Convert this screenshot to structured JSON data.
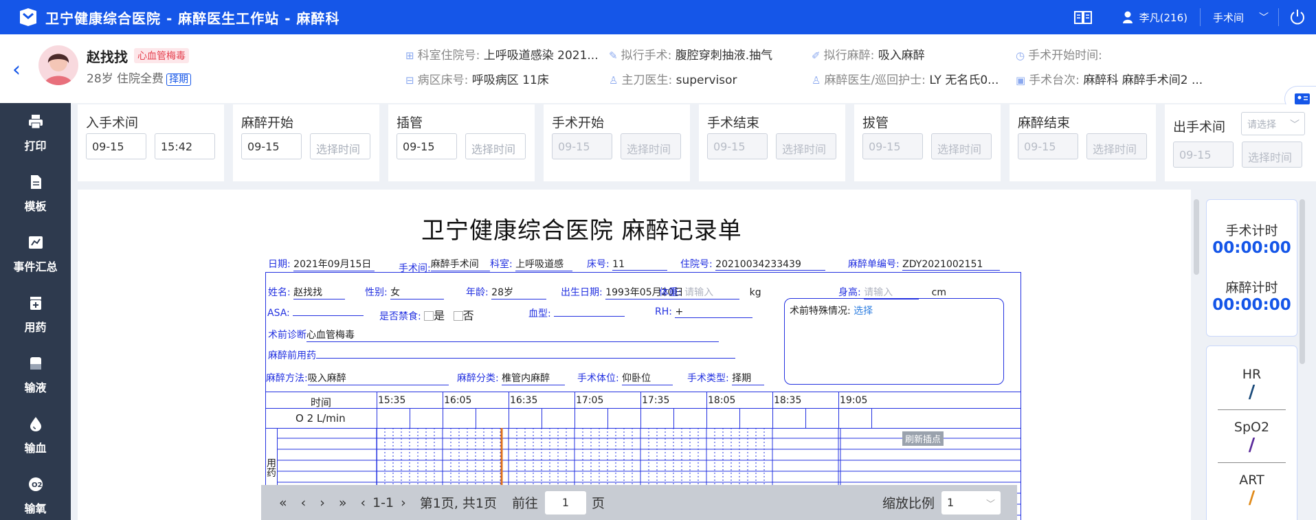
{
  "app": {
    "title": "卫宁健康综合医院 - 麻醉医生工作站 - 麻醉科",
    "user": "李凡(216)",
    "room": "手术间"
  },
  "patient": {
    "name": "赵找找",
    "tag": "心血管梅毒",
    "sub": "28岁 住院全费",
    "badge": "择期",
    "fields": [
      {
        "k": "科室住院号:",
        "v": "上呼吸道感染 2021..."
      },
      {
        "k": "病区床号:",
        "v": "呼吸病区 11床"
      },
      {
        "k": "拟行手术:",
        "v": "腹腔穿刺抽液.抽气"
      },
      {
        "k": "主刀医生:",
        "v": "supervisor"
      },
      {
        "k": "拟行麻醉:",
        "v": "吸入麻醉"
      },
      {
        "k": "麻醉医生/巡回护士:",
        "v": "LY 无名氏0..."
      },
      {
        "k": "手术开始时间:",
        "v": ""
      },
      {
        "k": "手术台次:",
        "v": "麻醉科 麻醉手术间2 ..."
      }
    ]
  },
  "sidebar": [
    "打印",
    "模板",
    "事件汇总",
    "用药",
    "输液",
    "输血",
    "输氧"
  ],
  "timeline": [
    {
      "label": "入手术间",
      "date": "09-15",
      "time": "15:42"
    },
    {
      "label": "麻醉开始",
      "date": "09-15",
      "time": "选择时间"
    },
    {
      "label": "插管",
      "date": "09-15",
      "time": "选择时间"
    },
    {
      "label": "手术开始",
      "date": "09-15",
      "time": "选择时间"
    },
    {
      "label": "手术结束",
      "date": "09-15",
      "time": "选择时间"
    },
    {
      "label": "拔管",
      "date": "09-15",
      "time": "选择时间"
    },
    {
      "label": "麻醉结束",
      "date": "09-15",
      "time": "选择时间"
    },
    {
      "label": "出手术间",
      "date": "09-15",
      "time": "选择时间",
      "select": "请选择"
    }
  ],
  "record": {
    "title": "卫宁健康综合医院  麻醉记录单",
    "date_k": "日期:",
    "date": "2021年09月15日",
    "room_k": "手术间:",
    "room": "麻醉手术间",
    "dept_k": "科室:",
    "dept": "上呼吸道感",
    "bed_k": "床号:",
    "bed": "11",
    "inpat_k": "住院号:",
    "inpat": "20210034233439",
    "sheet_k": "麻醉单编号:",
    "sheet": "ZDY2021002151",
    "name_k": "姓名:",
    "name": "赵找找",
    "sex_k": "性别:",
    "sex": "女",
    "age_k": "年龄:",
    "age": "28岁",
    "birth_k": "出生日期:",
    "birth": "1993年05月20日",
    "weight_k": "体重:",
    "weight_ph": "请输入",
    "weight_u": "kg",
    "height_k": "身高:",
    "height_ph": "请输入",
    "height_u": "cm",
    "asa_k": "ASA:",
    "fast_k": "是否禁食:",
    "yes": "是",
    "no": "否",
    "blood_k": "血型:",
    "rh_k": "RH:",
    "rh": "+",
    "special_k": "术前特殊情况:",
    "special_link": "选择",
    "diag_k": "术前诊断",
    "diag": "心血管梅毒",
    "premed_k": "麻醉前用药",
    "method_k": "麻醉方法:",
    "method": "吸入麻醉",
    "class_k": "麻醉分类:",
    "class": "椎管内麻醉",
    "pos_k": "手术体位:",
    "pos": "仰卧位",
    "type_k": "手术类型:",
    "type": "择期",
    "time_k": "时间",
    "o2_k": "O 2 L/min",
    "drug_k": "用药",
    "refresh": "刷新插点",
    "ticks": [
      "15:35",
      "16:05",
      "16:35",
      "17:05",
      "17:35",
      "18:05",
      "18:35",
      "19:05"
    ]
  },
  "pager": {
    "range": "1-1",
    "page": "第1页, 共1页",
    "goto": "前往",
    "gotoval": "1",
    "unit": "页",
    "zoom_k": "缩放比例",
    "zoom": "1"
  },
  "right": {
    "op_timer_k": "手术计时",
    "op_timer": "00:00:00",
    "an_timer_k": "麻醉计时",
    "an_timer": "00:00:00",
    "vitals": [
      {
        "name": "HR",
        "mark": "/",
        "color": "#1a4a7a"
      },
      {
        "name": "SpO2",
        "mark": "/",
        "color": "#5a2a9a"
      },
      {
        "name": "ART",
        "mark": "/",
        "color": "#e08a1a"
      }
    ]
  }
}
